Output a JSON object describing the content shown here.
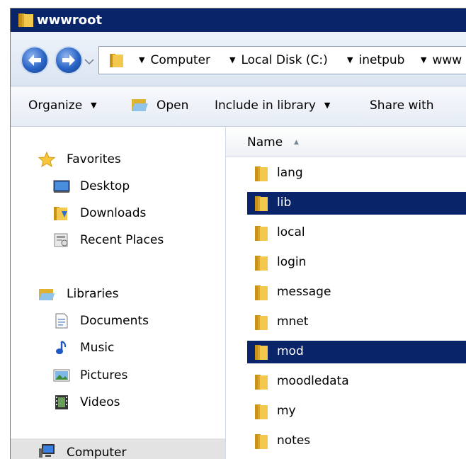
{
  "window": {
    "title": "wwwroot"
  },
  "address_bar": {
    "crumbs": [
      "Computer",
      "Local Disk (C:)",
      "inetpub",
      "www"
    ]
  },
  "toolbar": {
    "organize": "Organize",
    "open": "Open",
    "include_in_library": "Include in library",
    "share_with": "Share with"
  },
  "nav": {
    "favorites": "Favorites",
    "favorites_items": [
      "Desktop",
      "Downloads",
      "Recent Places"
    ],
    "libraries": "Libraries",
    "libraries_items": [
      "Documents",
      "Music",
      "Pictures",
      "Videos"
    ],
    "computer": "Computer"
  },
  "file_list": {
    "column_name": "Name",
    "items": [
      {
        "name": "lang",
        "selected": false
      },
      {
        "name": "lib",
        "selected": true
      },
      {
        "name": "local",
        "selected": false
      },
      {
        "name": "login",
        "selected": false
      },
      {
        "name": "message",
        "selected": false
      },
      {
        "name": "mnet",
        "selected": false
      },
      {
        "name": "mod",
        "selected": true
      },
      {
        "name": "moodledata",
        "selected": false
      },
      {
        "name": "my",
        "selected": false
      },
      {
        "name": "notes",
        "selected": false
      }
    ]
  },
  "colors": {
    "selection": "#0a246a",
    "titlebar": "#0a246a",
    "folder": "#e8b830"
  },
  "icons": [
    "folder-icon",
    "back-arrow-icon",
    "forward-arrow-icon",
    "star-icon",
    "desktop-icon",
    "downloads-icon",
    "recent-places-icon",
    "libraries-icon",
    "documents-icon",
    "music-icon",
    "pictures-icon",
    "videos-icon",
    "computer-icon"
  ]
}
